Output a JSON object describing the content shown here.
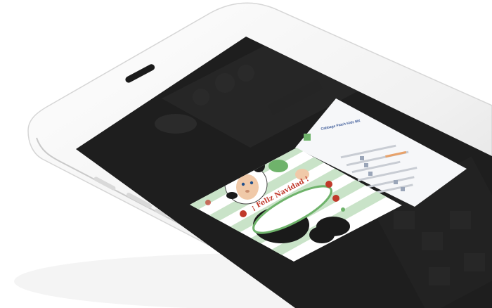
{
  "device": {
    "frame_color": "#f3f3f3",
    "screen_color": "#1e1e1e",
    "accent_shadow": "#d9d9d9"
  },
  "post": {
    "page_name": "Cabbage Patch Kids MX",
    "card_message": "¡ Feliz Navidad !"
  },
  "colors": {
    "facebook_blue": "#3b5998",
    "card_stripe": "#c9e3c8",
    "card_text": "#c0392b",
    "badge_green": "#6fb36b"
  }
}
